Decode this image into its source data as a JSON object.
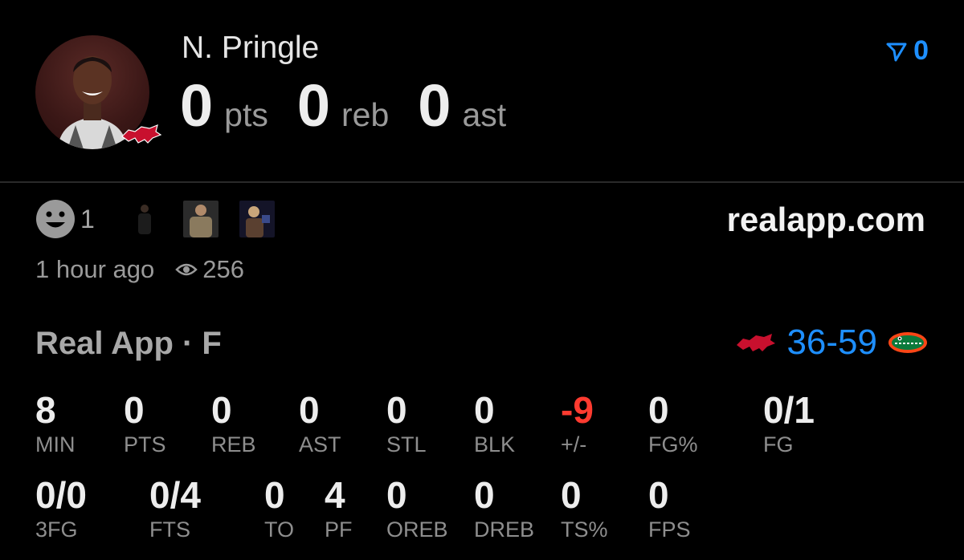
{
  "player": {
    "name": "N. Pringle",
    "pts": "0",
    "pts_unit": "pts",
    "reb": "0",
    "reb_unit": "reb",
    "ast": "0",
    "ast_unit": "ast"
  },
  "fire": {
    "count": "0",
    "icon": "fire-arrow-icon",
    "color": "#1e8fff"
  },
  "reactions": {
    "icon": "smiley-icon",
    "count": "1",
    "thumbnails": [
      "reaction-gif-1",
      "reaction-gif-2",
      "reaction-gif-3"
    ]
  },
  "source": {
    "domain": "realapp.com"
  },
  "meta": {
    "time": "1 hour ago",
    "views": "256",
    "icon": "eye-icon"
  },
  "game": {
    "title": "Real App · F",
    "score": "36-59",
    "home_team_icon": "razorback-icon",
    "away_team_icon": "gator-icon",
    "score_color": "#1e8fff"
  },
  "stats_row1": [
    {
      "value": "8",
      "label": "MIN"
    },
    {
      "value": "0",
      "label": "PTS"
    },
    {
      "value": "0",
      "label": "REB"
    },
    {
      "value": "0",
      "label": "AST"
    },
    {
      "value": "0",
      "label": "STL"
    },
    {
      "value": "0",
      "label": "BLK"
    },
    {
      "value": "-9",
      "label": "+/-"
    },
    {
      "value": "0",
      "label": "FG%"
    },
    {
      "value": "0/1",
      "label": "FG"
    }
  ],
  "stats_row2": [
    {
      "value": "0/0",
      "label": "3FG"
    },
    {
      "value": "0/4",
      "label": "FTS"
    },
    {
      "value": "0",
      "label": "TO"
    },
    {
      "value": "4",
      "label": "PF"
    },
    {
      "value": "0",
      "label": "OREB"
    },
    {
      "value": "0",
      "label": "DREB"
    },
    {
      "value": "0",
      "label": "TS%"
    },
    {
      "value": "0",
      "label": "FPS"
    }
  ],
  "colors": {
    "negative": "#ff3b30",
    "accent": "#1e8fff"
  }
}
